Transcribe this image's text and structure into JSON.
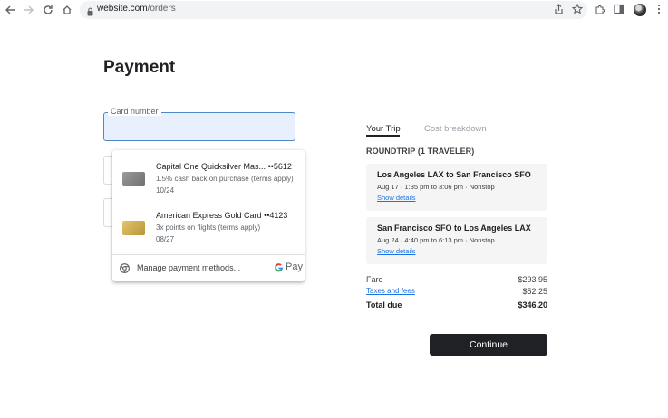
{
  "browser": {
    "url_host": "website.com",
    "url_path": "/orders"
  },
  "page": {
    "title": "Payment"
  },
  "card_field": {
    "label": "Card number",
    "value": ""
  },
  "autofill": {
    "suggestions": [
      {
        "name": "Capital One Quicksilver Mas...",
        "last4": "••5612",
        "benefit": "1.5% cash back on purchase (terms apply)",
        "expiry": "10/24",
        "card_color": "#8c8c8c"
      },
      {
        "name": "American Express Gold Card",
        "last4": "••4123",
        "benefit": "3x points on flights (terms apply)",
        "expiry": "08/27",
        "card_color": "#d4b455"
      }
    ],
    "manage_label": "Manage payment methods...",
    "gpay_label": "Pay"
  },
  "trip": {
    "tabs": [
      "Your Trip",
      "Cost breakdown"
    ],
    "heading": "ROUNDTRIP (1 TRAVELER)",
    "flights": [
      {
        "route": "Los Angeles LAX to San Francisco SFO",
        "times": "Aug 17 · 1:35 pm to 3:06 pm · Nonstop",
        "details": "Show details"
      },
      {
        "route": "San Francisco SFO to Los Angeles LAX",
        "times": "Aug 24 · 4:40 pm to 6:13 pm · Nonstop",
        "details": "Show details"
      }
    ],
    "costs": {
      "fare_label": "Fare",
      "fare_value": "$293.95",
      "taxes_label": "Taxes and fees",
      "taxes_value": "$52.25",
      "total_label": "Total due",
      "total_value": "$346.20"
    }
  },
  "actions": {
    "continue_label": "Continue"
  },
  "colors": {
    "accent_blue": "#1a73e8",
    "field_focus": "#4d88c7",
    "button_dark": "#202124"
  }
}
